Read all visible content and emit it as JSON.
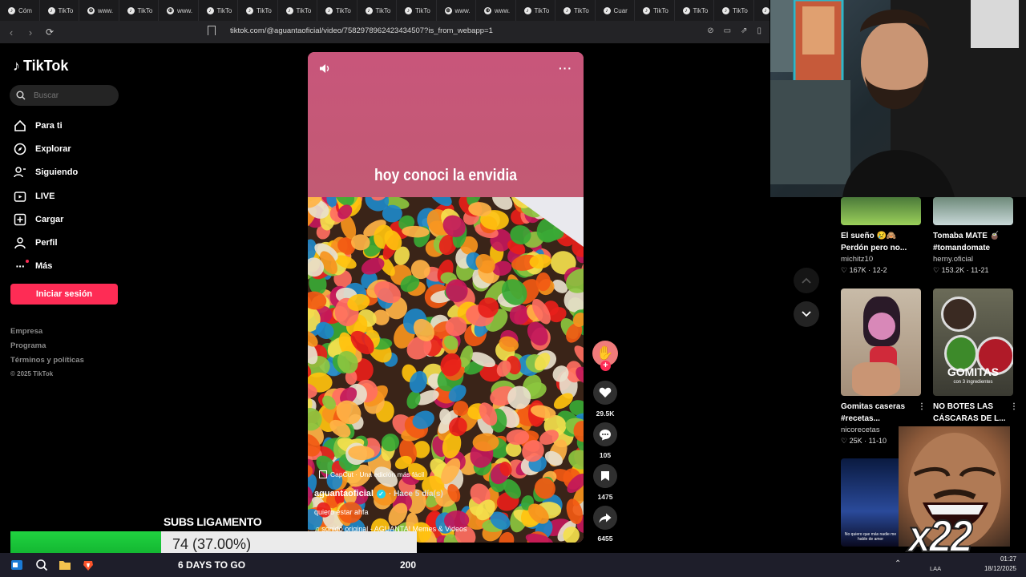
{
  "tabs": [
    {
      "icon": "tiktok",
      "label": "Cóm"
    },
    {
      "icon": "tiktok",
      "label": "TikTo"
    },
    {
      "icon": "globe",
      "label": "www."
    },
    {
      "icon": "tiktok",
      "label": "TikTo"
    },
    {
      "icon": "globe",
      "label": "www."
    },
    {
      "icon": "tiktok",
      "label": "TikTo"
    },
    {
      "icon": "tiktok",
      "label": "TikTo"
    },
    {
      "icon": "tiktok",
      "label": "TikTo"
    },
    {
      "icon": "tiktok",
      "label": "TikTo"
    },
    {
      "icon": "tiktok",
      "label": "TikTo"
    },
    {
      "icon": "tiktok",
      "label": "TikTo"
    },
    {
      "icon": "globe",
      "label": "www."
    },
    {
      "icon": "globe",
      "label": "www."
    },
    {
      "icon": "tiktok",
      "label": "TikTo"
    },
    {
      "icon": "tiktok",
      "label": "TikTo"
    },
    {
      "icon": "tiktok",
      "label": "Cuar"
    },
    {
      "icon": "tiktok",
      "label": "TikTo"
    },
    {
      "icon": "tiktok",
      "label": "TikTo"
    },
    {
      "icon": "tiktok",
      "label": "TikTo"
    },
    {
      "icon": "tiktok",
      "label": "TikTo"
    }
  ],
  "address": {
    "url": "tiktok.com/@aguantaoficial/video/7582978962423434507?is_from_webapp=1"
  },
  "sidebar": {
    "brand": "TikTok",
    "search_placeholder": "Buscar",
    "items": [
      {
        "icon": "home-icon",
        "label": "Para ti"
      },
      {
        "icon": "compass-icon",
        "label": "Explorar"
      },
      {
        "icon": "following-icon",
        "label": "Siguiendo"
      },
      {
        "icon": "live-icon",
        "label": "LIVE"
      },
      {
        "icon": "upload-icon",
        "label": "Cargar"
      },
      {
        "icon": "profile-icon",
        "label": "Perfil"
      },
      {
        "icon": "more-icon",
        "label": "Más"
      }
    ],
    "login_label": "Iniciar sesión",
    "footer": [
      "Empresa",
      "Programa",
      "Términos y políticas"
    ],
    "copyright": "© 2025 TikTok"
  },
  "video": {
    "caption": "hoy conoci la envidia",
    "capcut": "CapCut · Una edición más fácil",
    "author": "aguantaoficial",
    "posted": "· Hace 5 día(s)",
    "description": "quiero estar ahfa",
    "sound": "sonido original - AGUANTA! Memes & Videos"
  },
  "actions": {
    "likes": "29.5K",
    "comments": "105",
    "saves": "1475",
    "shares": "6455"
  },
  "related": [
    {
      "title_line1": "El sueño 😢🙈",
      "title_line2": "Perdón pero no...",
      "author": "michitz10",
      "likes": "167K",
      "date": "12-2"
    },
    {
      "title_line1": "Tomaba MATE 🧉",
      "title_line2": "#tomandomate",
      "author": "herny.oficial",
      "likes": "153.2K",
      "date": "11-21"
    },
    {
      "title_line1": "Gomitas caseras",
      "title_line2": "#recetas...",
      "author": "nicorecetas",
      "likes": "25K",
      "date": "11-10"
    },
    {
      "title_line1": "NO BOTES LAS",
      "title_line2": "CÁSCARAS DE L...",
      "author": "",
      "likes": "",
      "date": ""
    }
  ],
  "thumb_texts": {
    "gomitas": "GOMITAS",
    "gomitas_sub": "con 3 ingredientes",
    "bottom_caption": "No quiero que más nadie me hable de amor"
  },
  "overlay": {
    "subs_label": "SUBS LIGAMENTO",
    "goal_text": "74 (37.00%)",
    "goal_fraction": 0.37,
    "days_left": "6 DAYS TO GO",
    "target": "200",
    "meme_text": "x22"
  },
  "system": {
    "time": "01:27",
    "date": "18/12/2025",
    "lang": "LAA"
  }
}
